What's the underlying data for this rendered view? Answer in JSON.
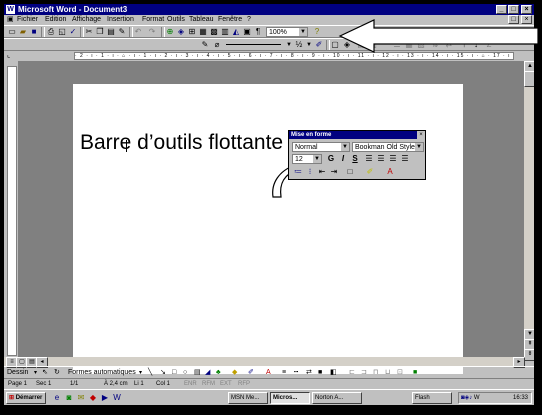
{
  "window": {
    "title": "Microsoft Word - Document3",
    "app_icon": "W",
    "controls": [
      "_",
      "□",
      "×"
    ]
  },
  "menu": {
    "items": [
      "Fichier",
      "Edition",
      "Affichage",
      "Insertion",
      "Format",
      "Outils",
      "Tableau",
      "Fenêtre",
      "?"
    ]
  },
  "toolbar_standard": {
    "zoom": "100%"
  },
  "toolbar_format": {
    "font_size": "½"
  },
  "ruler": {
    "marks": "· 2 · ı · 1 · ı · ⌂ · ı · 1 · ı · 2 · ı · 3 · ı · 4 · ı · 5 · ı · 6 · ı · 7 · ı · 8 · ı · 9 · ı · 10 · ı · 11 · ı · 12 · ı · 13 · ı · 14 · ı · 15 · ı · ⌂ · 17 · ı · 18 ·"
  },
  "document": {
    "annotation": "Barre d’outils flottante"
  },
  "floating_toolbar": {
    "title": "Mise en forme",
    "style": "Normal",
    "font": "Bookman Old Style",
    "size": "12",
    "bold": "G",
    "italic": "I",
    "underline": "S"
  },
  "drawing_toolbar": {
    "draw_label": "Dessin",
    "autoshapes_label": "Formes automatiques"
  },
  "status": {
    "page": "Page 1",
    "section": "Sec 1",
    "pages": "1/1",
    "at": "À 2,4 cm",
    "line": "Li 1",
    "col": "Col 1",
    "modes": [
      "ENR",
      "RFM",
      "EXT",
      "RFP"
    ]
  },
  "taskbar": {
    "start": "Démarrer",
    "tasks": [
      "MSN Me...",
      "Micros...",
      "Norton A..."
    ],
    "flash": "Flash",
    "clock": "16:33"
  },
  "colors": {
    "titlebar": "#000080",
    "face": "#c0c0c0",
    "desktop": "#808080",
    "page": "#ffffff",
    "arrow": "#ffffff"
  },
  "icons": [
    "word-app-icon",
    "new-doc-icon",
    "open-icon",
    "save-icon",
    "print-icon",
    "preview-icon",
    "spell-icon",
    "cut-icon",
    "copy-icon",
    "paste-icon",
    "undo-icon",
    "redo-icon",
    "hyperlink-icon",
    "table-icon",
    "columns-icon",
    "drawing-icon",
    "pilcrow-icon",
    "help-icon",
    "bullets-icon",
    "numbering-icon",
    "indent-icon",
    "highlight-icon",
    "font-color-icon",
    "start-windows-icon",
    "volume-icon"
  ]
}
